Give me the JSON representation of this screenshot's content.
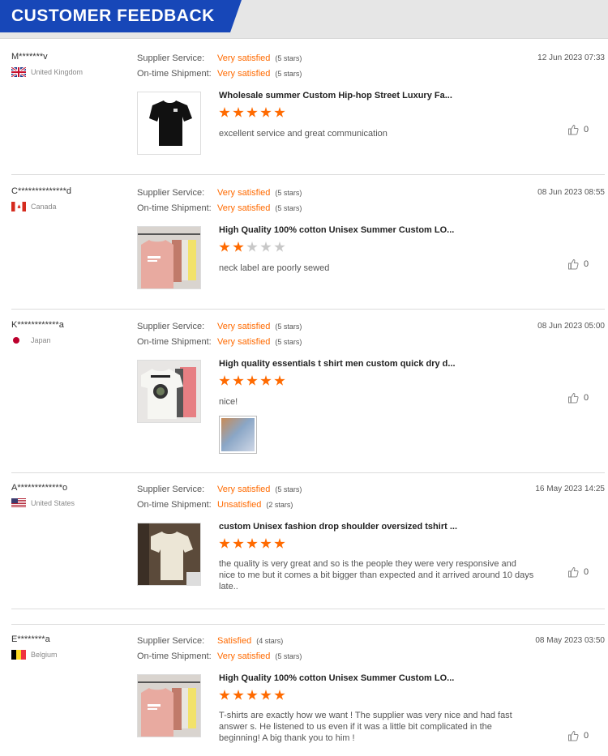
{
  "header": {
    "title": "CUSTOMER FEEDBACK"
  },
  "labels": {
    "supplier_service": "Supplier Service:",
    "ontime_shipment": "On-time Shipment:"
  },
  "colors": {
    "accent": "#ff6a00",
    "header": "#1747b8"
  },
  "reviews": [
    {
      "name": "M*******v",
      "country": "United Kingdom",
      "flag": "uk",
      "date": "12 Jun 2023 07:33",
      "supplier_rating": "Very satisfied",
      "supplier_stars": "(5 stars)",
      "shipment_rating": "Very satisfied",
      "shipment_stars": "(5 stars)",
      "product_title": "Wholesale summer Custom Hip-hop Street Luxury Fa...",
      "product_stars": 5,
      "comment": "excellent service and great communication",
      "likes": "0",
      "thumb": "black-tshirt"
    },
    {
      "name": "C**************d",
      "country": "Canada",
      "flag": "canada",
      "date": "08 Jun 2023 08:55",
      "supplier_rating": "Very satisfied",
      "supplier_stars": "(5 stars)",
      "shipment_rating": "Very satisfied",
      "shipment_stars": "(5 stars)",
      "product_title": "High Quality 100% cotton Unisex Summer Custom LO...",
      "product_stars": 2,
      "comment": "neck label are poorly sewed",
      "likes": "0",
      "thumb": "pink-rack"
    },
    {
      "name": "K************a",
      "country": "Japan",
      "flag": "japan",
      "date": "08 Jun 2023 05:00",
      "supplier_rating": "Very satisfied",
      "supplier_stars": "(5 stars)",
      "shipment_rating": "Very satisfied",
      "shipment_stars": "(5 stars)",
      "product_title": "High quality essentials t shirt men custom quick dry d...",
      "product_stars": 5,
      "comment": "nice!",
      "likes": "0",
      "thumb": "white-print",
      "has_attachment": true
    },
    {
      "name": "A*************o",
      "country": "United States",
      "flag": "us",
      "date": "16 May 2023 14:25",
      "supplier_rating": "Very satisfied",
      "supplier_stars": "(5 stars)",
      "shipment_rating": "Unsatisfied",
      "shipment_stars": "(2 stars)",
      "product_title": "custom Unisex fashion drop shoulder oversized tshirt ...",
      "product_stars": 5,
      "comment": "the quality is very great and so is the people they were very responsive and nice to me but it comes a bit bigger than expected and it arrived around 10 days late..",
      "likes": "0",
      "thumb": "cream-tshirt"
    },
    {
      "name": "E********a",
      "country": "Belgium",
      "flag": "belgium",
      "date": "08 May 2023 03:50",
      "supplier_rating": "Satisfied",
      "supplier_stars": "(4 stars)",
      "shipment_rating": "Very satisfied",
      "shipment_stars": "(5 stars)",
      "product_title": "High Quality 100% cotton Unisex Summer Custom LO...",
      "product_stars": 5,
      "comment": "T-shirts are exactly how we want ! The supplier was very nice and had fast answer s. He listened to us even if it was a little bit complicated in the beginning! A big thank you to him !",
      "likes": "0",
      "thumb": "pink-rack"
    }
  ]
}
